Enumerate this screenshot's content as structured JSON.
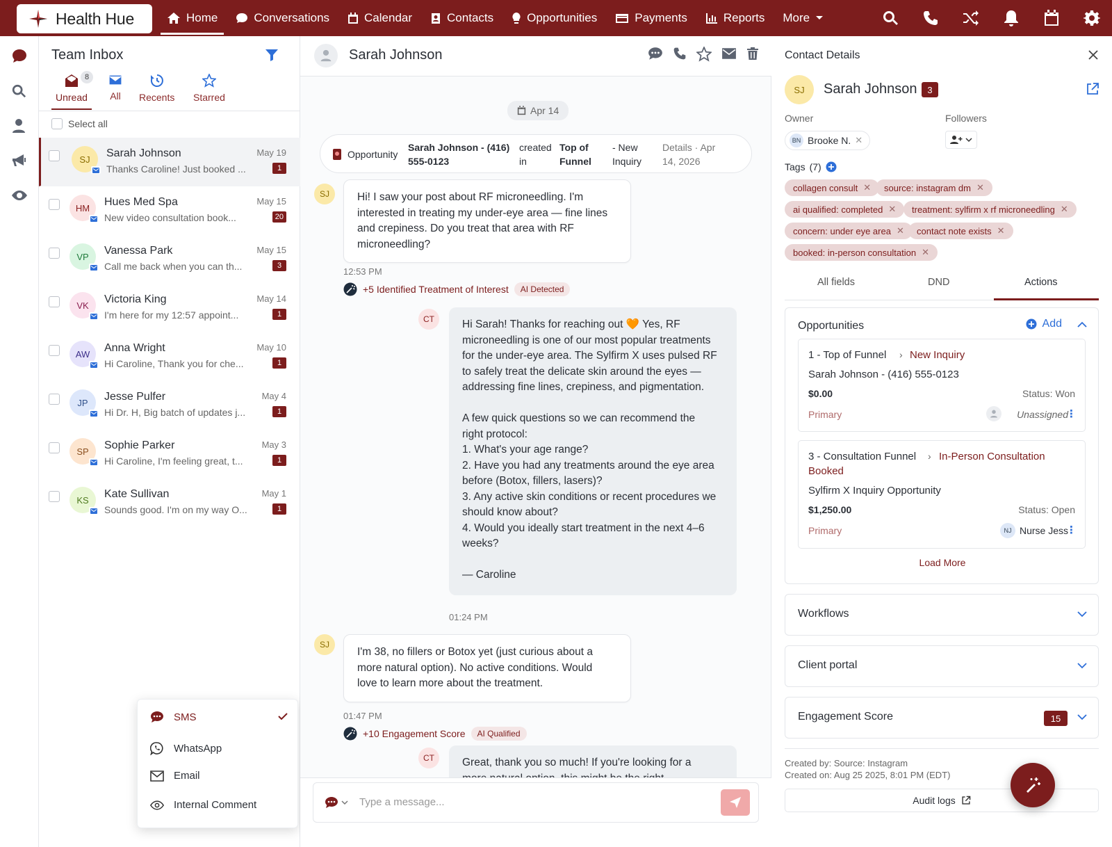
{
  "brand": {
    "name": "Health Hue",
    "color": "#7c1d1d"
  },
  "nav": [
    {
      "label": "Home",
      "icon": "home-icon",
      "active": true
    },
    {
      "label": "Conversations",
      "icon": "chat-icon"
    },
    {
      "label": "Calendar",
      "icon": "calendar-icon"
    },
    {
      "label": "Contacts",
      "icon": "contacts-icon"
    },
    {
      "label": "Opportunities",
      "icon": "lightbulb-icon"
    },
    {
      "label": "Payments",
      "icon": "card-icon"
    },
    {
      "label": "Reports",
      "icon": "chart-icon"
    },
    {
      "label": "More",
      "icon": "chevron-down-icon"
    }
  ],
  "inbox": {
    "title": "Team Inbox",
    "tabs": [
      {
        "label": "Unread",
        "badge": "8"
      },
      {
        "label": "All"
      },
      {
        "label": "Recents"
      },
      {
        "label": "Starred"
      }
    ],
    "select_all": "Select all",
    "conversations": [
      {
        "initials": "SJ",
        "name": "Sarah Johnson",
        "preview": "Thanks Caroline! Just booked ...",
        "date": "May 19",
        "count": "1",
        "bg": "#fbe9a8",
        "fg": "#8a6d00"
      },
      {
        "initials": "HM",
        "name": "Hues Med Spa",
        "preview": "New video consultation book...",
        "date": "May 15",
        "count": "20",
        "bg": "#fbe3e3",
        "fg": "#8a1f1f"
      },
      {
        "initials": "VP",
        "name": "Vanessa Park",
        "preview": "Call me back when you can th...",
        "date": "May 15",
        "count": "3",
        "bg": "#d9f5e1",
        "fg": "#1f7a3b"
      },
      {
        "initials": "VK",
        "name": "Victoria King",
        "preview": "I'm here for my 12:57 appoint...",
        "date": "May 14",
        "count": "1",
        "bg": "#fbe3ee",
        "fg": "#8a1f4f"
      },
      {
        "initials": "AW",
        "name": "Anna Wright",
        "preview": "Hi Caroline, Thank you for che...",
        "date": "May 10",
        "count": "1",
        "bg": "#e6e3fb",
        "fg": "#3d2f8a"
      },
      {
        "initials": "JP",
        "name": "Jesse Pulfer",
        "preview": "Hi Dr. H, Big batch of updates j...",
        "date": "May 4",
        "count": "1",
        "bg": "#dde7fb",
        "fg": "#2f4f8a"
      },
      {
        "initials": "SP",
        "name": "Sophie Parker",
        "preview": "Hi Caroline, I'm feeling great, t...",
        "date": "May 3",
        "count": "1",
        "bg": "#fde5cf",
        "fg": "#8a4f1f"
      },
      {
        "initials": "KS",
        "name": "Kate Sullivan",
        "preview": "Sounds good. I'm on my way O...",
        "date": "May 1",
        "count": "1",
        "bg": "#e9f7d4",
        "fg": "#4f7a1f"
      }
    ]
  },
  "channel_menu": [
    {
      "label": "SMS",
      "selected": true
    },
    {
      "label": "WhatsApp"
    },
    {
      "label": "Email"
    },
    {
      "label": "Internal Comment"
    }
  ],
  "chat": {
    "name": "Sarah Johnson",
    "date_pill": "Apr 14",
    "opp": {
      "label": "Opportunity",
      "contact_l1": "Sarah Johnson - (416)",
      "contact_l2": "555-0123",
      "created_l1": "created",
      "created_l2": "in",
      "funnel_l1": "Top of",
      "funnel_l2": "Funnel",
      "stage_l1": "- New",
      "stage_l2": "Inquiry",
      "details_l1": "Details · Apr",
      "details_l2": "14, 2026"
    },
    "m1": {
      "avatar": "SJ",
      "lines": [
        "Hi! I saw your post about RF microneedling. I'm",
        "interested in treating my under-eye area — fine lines",
        "and crepiness. Do you treat that area with RF",
        "microneedling?"
      ],
      "time": "12:53 PM"
    },
    "ai1": {
      "text": "+5 Identified Treatment of Interest",
      "badge": "AI Detected"
    },
    "m2": {
      "avatar": "CT",
      "lines": [
        "Hi Sarah! Thanks for reaching out 🧡 Yes, RF",
        "microneedling is one of our most popular treatments",
        "for the under-eye area. The Sylfirm X uses pulsed RF",
        "to safely treat the delicate skin around the eyes —",
        "addressing fine lines, crepiness, and pigmentation.",
        "",
        "A few quick questions so we can recommend the",
        "right protocol:",
        "1. What's your age range?",
        "2. Have you had any treatments around the eye area",
        "before (Botox, fillers, lasers)?",
        "3. Any active skin conditions or recent procedures we",
        "should know about?",
        "4. Would you ideally start treatment in the next 4–6",
        "weeks?",
        "",
        "— Caroline"
      ],
      "time": "01:24 PM"
    },
    "m3": {
      "avatar": "SJ",
      "lines": [
        "I'm 38, no fillers or Botox yet (just curious about a",
        "more natural option). No active conditions. Would",
        "love to learn more about the treatment."
      ],
      "time": "01:47 PM"
    },
    "ai2": {
      "text": "+10 Engagement Score",
      "badge": "AI Qualified"
    },
    "m4": {
      "avatar": "CT",
      "lines": [
        "Great, thank you so much! If you're looking for a",
        "more natural option, this might be the right"
      ]
    },
    "composer_placeholder": "Type a message..."
  },
  "details": {
    "title": "Contact Details",
    "initials": "SJ",
    "name": "Sarah Johnson",
    "count": "3",
    "owner_label": "Owner",
    "owner_initials": "BN",
    "owner": "Brooke N.",
    "followers_label": "Followers",
    "tags_label": "Tags",
    "tags_count": "(7)",
    "tags": [
      "collagen consult",
      "source: instagram dm",
      "ai qualified: completed",
      "treatment: sylfirm x rf microneedling",
      "concern: under eye area",
      "contact note exists",
      "booked: in-person consultation"
    ],
    "tabs": [
      "All fields",
      "DND",
      "Actions"
    ],
    "opportunities": {
      "title": "Opportunities",
      "add": "Add",
      "items": [
        {
          "pipeline": "1 - Top of Funnel",
          "stage": "New Inquiry",
          "name": "Sarah Johnson - (416) 555-0123",
          "value": "$0.00",
          "status": "Status: Won",
          "primary": "Primary",
          "assignee": "Unassigned"
        },
        {
          "pipeline": "3 - Consultation Funnel",
          "stage_l1": "In-Person Consultation",
          "stage_l2": "Booked",
          "name": "Sylfirm X Inquiry Opportunity",
          "value": "$1,250.00",
          "status": "Status: Open",
          "primary": "Primary",
          "assignee_initials": "NJ",
          "assignee": "Nurse Jess"
        }
      ],
      "load_more": "Load More"
    },
    "workflows": "Workflows",
    "client_portal": "Client portal",
    "engagement": {
      "title": "Engagement Score",
      "value": "15"
    },
    "created_by": "Created by: Source: Instagram",
    "created_on": "Created on: Aug 25 2025, 8:01 PM (EDT)",
    "audit": "Audit logs"
  }
}
